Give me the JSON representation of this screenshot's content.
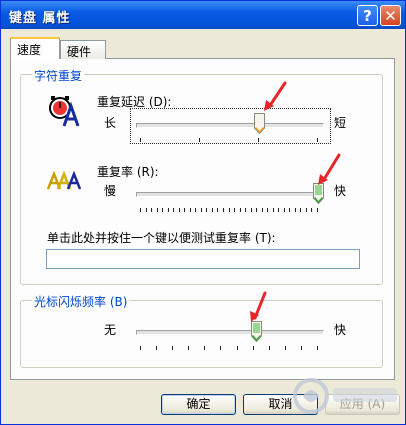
{
  "window": {
    "title": "键盘 属性"
  },
  "titlebar_buttons": {
    "help_icon": "?",
    "close_icon": "✕"
  },
  "tabs": [
    {
      "label": "速度",
      "active": true
    },
    {
      "label": "硬件",
      "active": false
    }
  ],
  "char_repeat": {
    "legend": "字符重复",
    "delay": {
      "label": "重复延迟 (D):",
      "min_label": "长",
      "max_label": "短",
      "level_fraction": 0.67
    },
    "rate": {
      "label": "重复率 (R):",
      "min_label": "慢",
      "max_label": "快",
      "level_fraction": 1.0
    },
    "test_label": "单击此处并按住一个键以便测试重复率 (T):",
    "test_value": ""
  },
  "cursor_blink": {
    "legend": "光标闪烁频率 (B)",
    "min_label": "无",
    "max_label": "快",
    "level_fraction": 0.65
  },
  "buttons": {
    "ok": "确定",
    "cancel": "取消",
    "apply": "应用 (A)"
  },
  "colors": {
    "title_bar": "#0a5ae6",
    "legend_text": "#0046d5",
    "annotation_arrow": "#e8262a"
  }
}
